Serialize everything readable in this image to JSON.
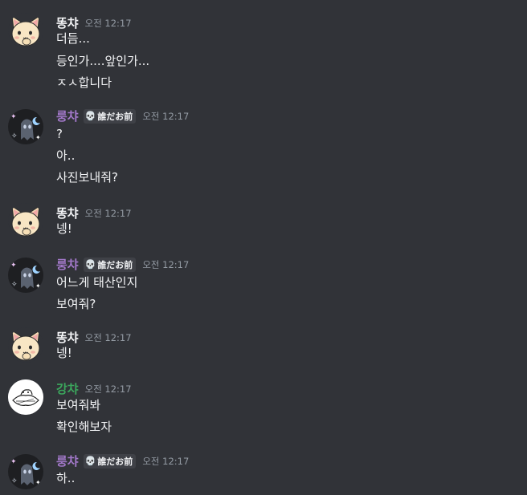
{
  "colors": {
    "background": "#313338",
    "name_ttongcha": "#f2f3f5",
    "name_rungcha": "#a278c9",
    "name_gangcha": "#3ba55c",
    "timestamp": "#949ba4"
  },
  "messages": [
    {
      "author": "똥챠",
      "timestamp": "오전 12:17",
      "lines": [
        "더듬...",
        "등인가....앞인가...",
        "ㅈㅅ합니다"
      ]
    },
    {
      "author": "룽챠",
      "badge": "誰だお前",
      "badge_icon": "skull-icon",
      "timestamp": "오전 12:17",
      "lines": [
        "?",
        "아..",
        "사진보내줘?"
      ]
    },
    {
      "author": "똥챠",
      "timestamp": "오전 12:17",
      "lines": [
        "넹!"
      ]
    },
    {
      "author": "룽챠",
      "badge": "誰だお前",
      "badge_icon": "skull-icon",
      "timestamp": "오전 12:17",
      "lines": [
        "어느게 태산인지",
        "보여줘?"
      ]
    },
    {
      "author": "똥챠",
      "timestamp": "오전 12:17",
      "lines": [
        "넹!"
      ]
    },
    {
      "author": "강챠",
      "timestamp": "오전 12:17",
      "lines": [
        "보여줘봐",
        "확인해보자"
      ]
    },
    {
      "author": "룽챠",
      "badge": "誰だお前",
      "badge_icon": "skull-icon",
      "timestamp": "오전 12:17",
      "lines": [
        "하.."
      ]
    }
  ]
}
